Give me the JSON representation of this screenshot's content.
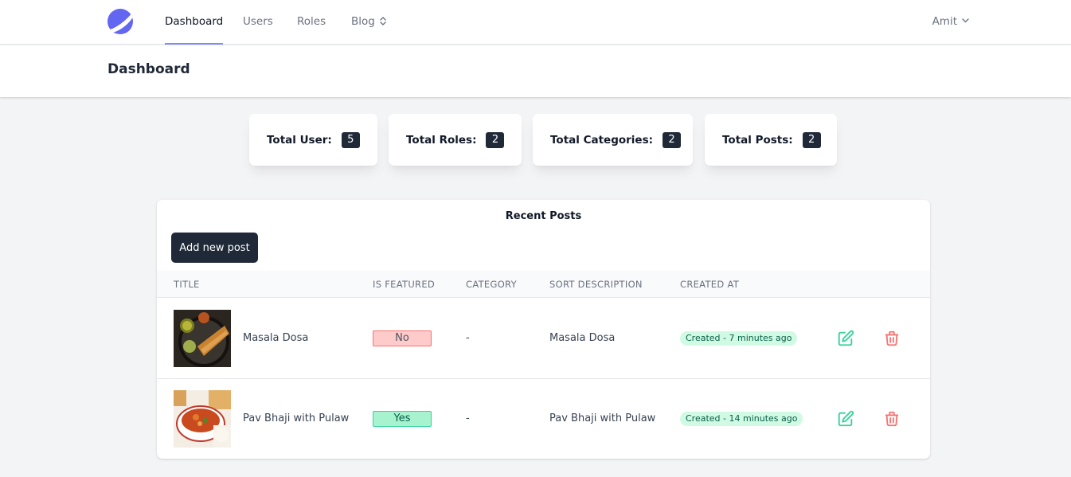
{
  "nav": {
    "logo_icon": "planet-logo-icon",
    "links": [
      {
        "label": "Dashboard",
        "active": true
      },
      {
        "label": "Users",
        "active": false
      },
      {
        "label": "Roles",
        "active": false
      },
      {
        "label": "Blog",
        "active": false,
        "icon": "sort-icon"
      }
    ],
    "user": {
      "name": "Amit",
      "icon": "chevron-down-icon"
    }
  },
  "header": {
    "title": "Dashboard"
  },
  "stats": [
    {
      "label": "Total User:",
      "value": "5"
    },
    {
      "label": "Total Roles:",
      "value": "2"
    },
    {
      "label": "Total Categories:",
      "value": "2"
    },
    {
      "label": "Total Posts:",
      "value": "2"
    }
  ],
  "recent_posts": {
    "title": "Recent Posts",
    "add_label": "Add new post",
    "columns": [
      "TITLE",
      "IS FEATURED",
      "CATEGORY",
      "SORT DESCRIPTION",
      "CREATED AT"
    ],
    "rows": [
      {
        "title": "Masala Dosa",
        "featured": "No",
        "category": "-",
        "description": "Masala Dosa",
        "created": "Created - 7 minutes ago",
        "edit_icon": "edit-icon",
        "delete_icon": "trash-icon"
      },
      {
        "title": "Pav Bhaji with Pulaw",
        "featured": "Yes",
        "category": "-",
        "description": "Pav Bhaji with Pulaw",
        "created": "Created - 14 minutes ago",
        "edit_icon": "edit-icon",
        "delete_icon": "trash-icon"
      }
    ]
  },
  "colors": {
    "accent": "#6366f1",
    "nav_indicator": "#818cf8",
    "dark": "#1f2937",
    "featured_no_bg": "#fecaca",
    "featured_yes_bg": "#a7f3d0",
    "created_bg": "#d1fae5",
    "edit_icon": "#34d399",
    "delete_icon": "#f87171"
  }
}
